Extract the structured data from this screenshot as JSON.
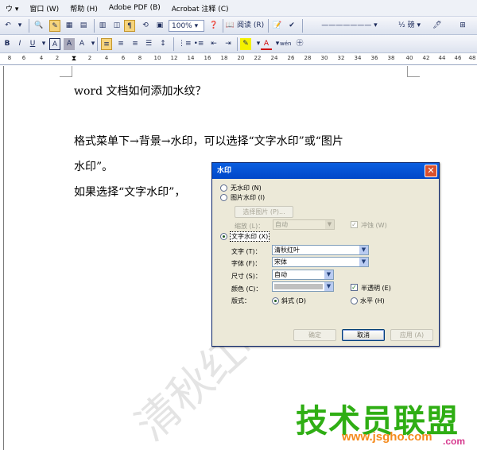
{
  "menubar": {
    "items": [
      "ウ ▾",
      "窗口 (W)",
      "帮助 (H)",
      "Adobe PDF (B)",
      "Acrobat 注释 (C)"
    ]
  },
  "toolbar1": {
    "zoom": "100%",
    "read_button": "阅读 (R)",
    "font_size": "½ 磅"
  },
  "toolbar2": {
    "bold": "B",
    "underline": "U",
    "char_border": "A",
    "char_shade": "A",
    "scale": "A",
    "phonetic": "wén"
  },
  "ruler": {
    "labels": [
      "8",
      "6",
      "4",
      "2",
      "2",
      "4",
      "6",
      "8",
      "10",
      "12",
      "14",
      "16",
      "18",
      "20",
      "22",
      "24",
      "26",
      "28",
      "30",
      "32",
      "34",
      "36",
      "38",
      "40",
      "42",
      "44",
      "46",
      "48"
    ]
  },
  "document": {
    "line1": "word 文档如何添加水纹？",
    "line2": "格式菜单下→背景→水印，可以选择“文字水印”或“图片",
    "line3": "水印”。",
    "line4": "如果选择“文字水印”，"
  },
  "watermark_text": "清秋红叶",
  "dialog": {
    "title": "水印",
    "close": "✕",
    "no_watermark": "无水印 (N)",
    "picture_watermark": "图片水印 (I)",
    "select_picture": "选择图片 (P)...",
    "scale_label": "缩放 (L)：",
    "scale_value": "自动",
    "washout_label": "冲蚀 (W)",
    "text_watermark": "文字水印 (X)",
    "text_label": "文字 (T)：",
    "text_value": "清秋红叶",
    "font_label": "字体 (F)：",
    "font_value": "宋体",
    "size_label": "尺寸 (S)：",
    "size_value": "自动",
    "color_label": "颜色 (C)：",
    "semi_transparent": "半透明 (E)",
    "layout_label": "版式：",
    "diagonal": "斜式 (D)",
    "horizontal": "水平 (H)",
    "ok": "确定",
    "cancel": "取消",
    "apply": "应用 (A)"
  },
  "logo": {
    "cn": "技术员联盟",
    "url": "www.jsgho.com",
    "suffix": ".com"
  }
}
